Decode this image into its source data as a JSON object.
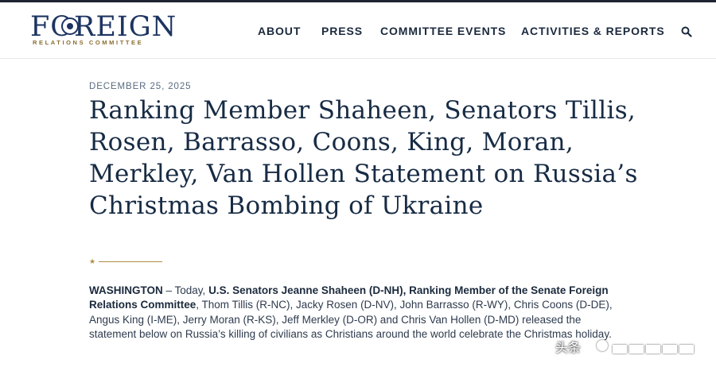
{
  "header": {
    "logo_main": "FOREIGN",
    "logo_sub": "RELATIONS COMMITTEE",
    "nav": {
      "about": "ABOUT",
      "press": "PRESS",
      "events": "COMMITTEE EVENTS",
      "reports": "ACTIVITIES & REPORTS"
    },
    "search_icon": "search-icon"
  },
  "article": {
    "date": "DECEMBER 25, 2025",
    "title": "Ranking Member Shaheen, Senators Tillis, Rosen, Barrasso, Coons, King, Moran, Merkley, Van Hollen Statement on Russia’s Christmas Bombing of Ukraine",
    "divider_icon": "star-icon",
    "dateline": "WASHINGTON",
    "intro_plain_1": " – Today, ",
    "intro_bold": "U.S. Senators Jeanne Shaheen (D-NH), Ranking Member of the Senate Foreign Relations Committee",
    "intro_plain_2": ", Thom Tillis (R-NC), Jacky Rosen (D-NV), John Barrasso (R-WY), Chris Coons (D-DE), Angus King (I-ME), Jerry Moran (R-KS), Jeff Merkley (D-OR) and Chris Van Hollen (D-MD) released the statement below on Russia’s killing of civilians as Christians around the world celebrate the Christmas holiday."
  },
  "watermark": {
    "text": "头条"
  },
  "colors": {
    "navy": "#1d3461",
    "gold": "#b08d42",
    "text": "#2e3b4e"
  }
}
